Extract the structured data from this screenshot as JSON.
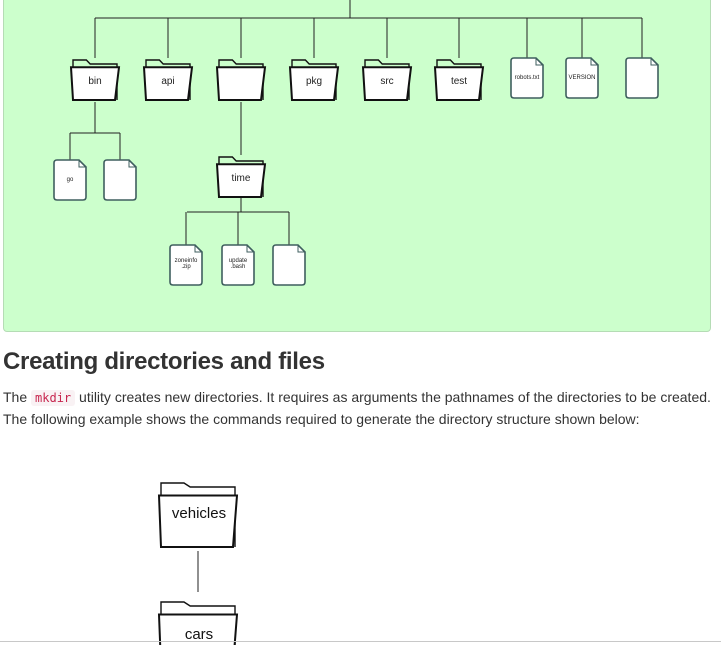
{
  "tree": {
    "level1": [
      {
        "type": "folder",
        "label": "bin"
      },
      {
        "type": "folder",
        "label": "api"
      },
      {
        "type": "folder",
        "label": ""
      },
      {
        "type": "folder",
        "label": "pkg"
      },
      {
        "type": "folder",
        "label": "src"
      },
      {
        "type": "folder",
        "label": "test"
      },
      {
        "type": "file",
        "label": "robots.txt"
      },
      {
        "type": "file",
        "label": "VERSION"
      },
      {
        "type": "file",
        "label": ""
      }
    ],
    "bin_children": [
      {
        "type": "file",
        "label": "go"
      },
      {
        "type": "file",
        "label": ""
      }
    ],
    "time_folder": {
      "type": "folder",
      "label": "time"
    },
    "time_children": [
      {
        "type": "file",
        "label": "zoneinfo\n.zip"
      },
      {
        "type": "file",
        "label": "update\n.bash"
      },
      {
        "type": "file",
        "label": ""
      }
    ]
  },
  "section": {
    "heading": "Creating directories and files",
    "para_before": "The ",
    "code": "mkdir",
    "para_after": " utility creates new directories. It requires as arguments the pathnames of the directories to be created. The following example shows the commands required to generate the directory structure shown below:"
  },
  "example_tree": {
    "root": "vehicles",
    "child": "cars"
  },
  "colors": {
    "panel_bg": "#ccffcc",
    "code_text": "#c7254e"
  }
}
